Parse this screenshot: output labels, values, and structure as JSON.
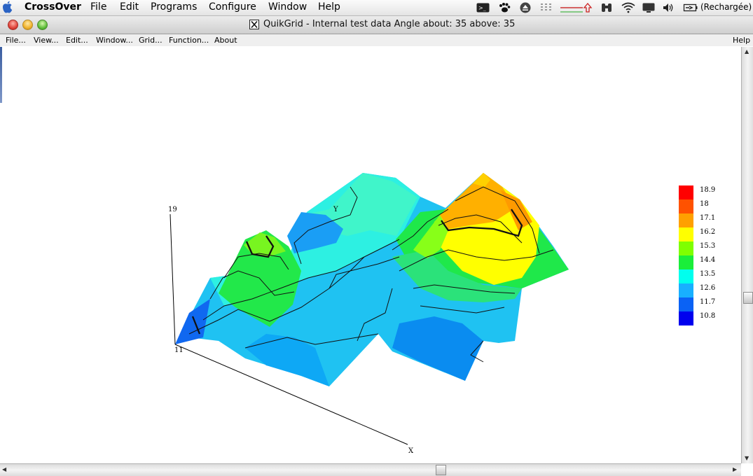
{
  "menubar": {
    "app_name": "CrossOver",
    "items": [
      "File",
      "Edit",
      "Programs",
      "Configure",
      "Window",
      "Help"
    ],
    "battery_status": "(Rechargée)"
  },
  "window": {
    "title": "QuikGrid - Internal test data Angle about: 35 above: 35"
  },
  "app_menu": {
    "items": [
      "File...",
      "View...",
      "Edit...",
      "Window...",
      "Grid...",
      "Function...",
      "About"
    ],
    "help": "Help"
  },
  "plot": {
    "axis_top_label": "19",
    "axis_origin_label": "11",
    "x_axis_label": "X",
    "y_axis_label": "Y",
    "view_angle_about": 35,
    "view_angle_above": 35
  },
  "legend": {
    "entries": [
      {
        "value": "18.9",
        "color": "#ff0000"
      },
      {
        "value": "18",
        "color": "#ff5200"
      },
      {
        "value": "17.1",
        "color": "#ffa000"
      },
      {
        "value": "16.2",
        "color": "#ffff00"
      },
      {
        "value": "15.3",
        "color": "#7fff00"
      },
      {
        "value": "14.4",
        "color": "#1aee3a"
      },
      {
        "value": "13.5",
        "color": "#00ffee"
      },
      {
        "value": "12.6",
        "color": "#18b0ff"
      },
      {
        "value": "11.7",
        "color": "#0a62f5"
      },
      {
        "value": "10.8",
        "color": "#0000ee"
      }
    ]
  },
  "colors": {
    "menubar_bg": "#ececec",
    "plot_bg": "#ffffff"
  }
}
